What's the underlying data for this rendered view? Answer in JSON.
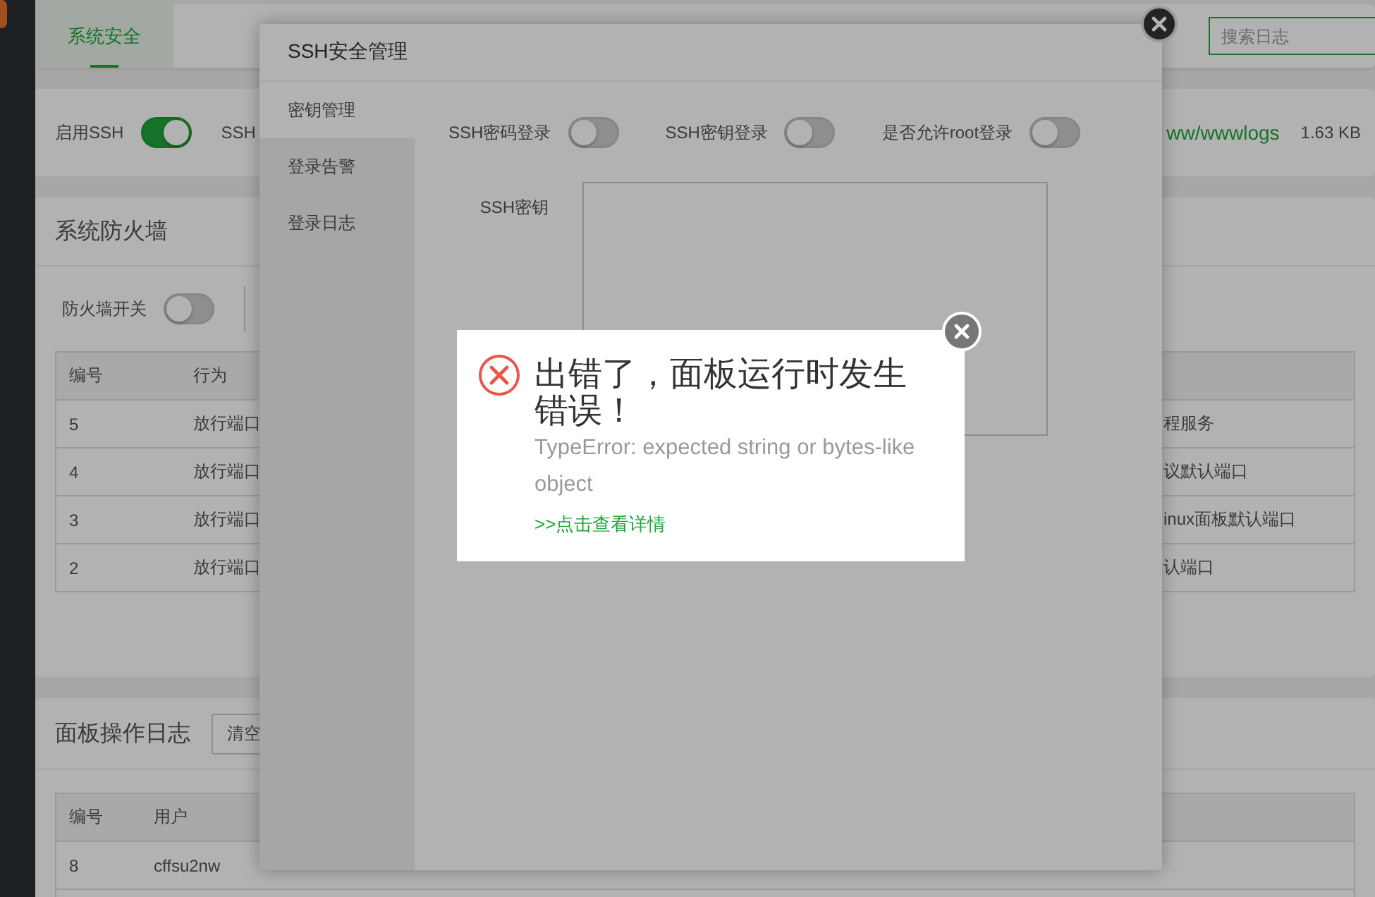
{
  "tabs": [
    {
      "label": "系统安全",
      "selected": true
    }
  ],
  "search": {
    "placeholder": "搜索日志"
  },
  "ssh_panel": {
    "enable_label": "启用SSH",
    "enabled": true,
    "port_label": "SSH",
    "log_path": "ww/wwwlogs",
    "log_size": "1.63 KB"
  },
  "firewall": {
    "title": "系统防火墙",
    "switch_label": "防火墙开关",
    "on": false,
    "columns": [
      "编号",
      "行为"
    ],
    "rows": [
      {
        "id": "5",
        "action": "放行端口",
        "column_3": "程服务"
      },
      {
        "id": "4",
        "action": "放行端口",
        "column_3": "议默认端口"
      },
      {
        "id": "3",
        "action": "放行端口",
        "column_3": "inux面板默认端口"
      },
      {
        "id": "2",
        "action": "放行端口",
        "column_3": "认端口"
      }
    ]
  },
  "operation_log": {
    "title": "面板操作日志",
    "clear_button": "清空",
    "columns": [
      "编号",
      "用户"
    ],
    "rows": [
      {
        "id": "8",
        "user": "cffsu2nw"
      }
    ]
  },
  "ssh_dialog": {
    "title": "SSH安全管理",
    "menu": [
      {
        "label": "密钥管理",
        "selected": true
      },
      {
        "label": "登录告警",
        "selected": false
      },
      {
        "label": "登录日志",
        "selected": false
      }
    ],
    "switches": [
      {
        "label": "SSH密码登录",
        "on": false
      },
      {
        "label": "SSH密钥登录",
        "on": false
      },
      {
        "label": "是否允许root登录",
        "on": false
      }
    ],
    "key_label": "SSH密钥"
  },
  "error_dialog": {
    "title": "出错了，面板运行时发生错误！",
    "message": "TypeError: expected string or bytes-like object",
    "link": ">>点击查看详情"
  }
}
